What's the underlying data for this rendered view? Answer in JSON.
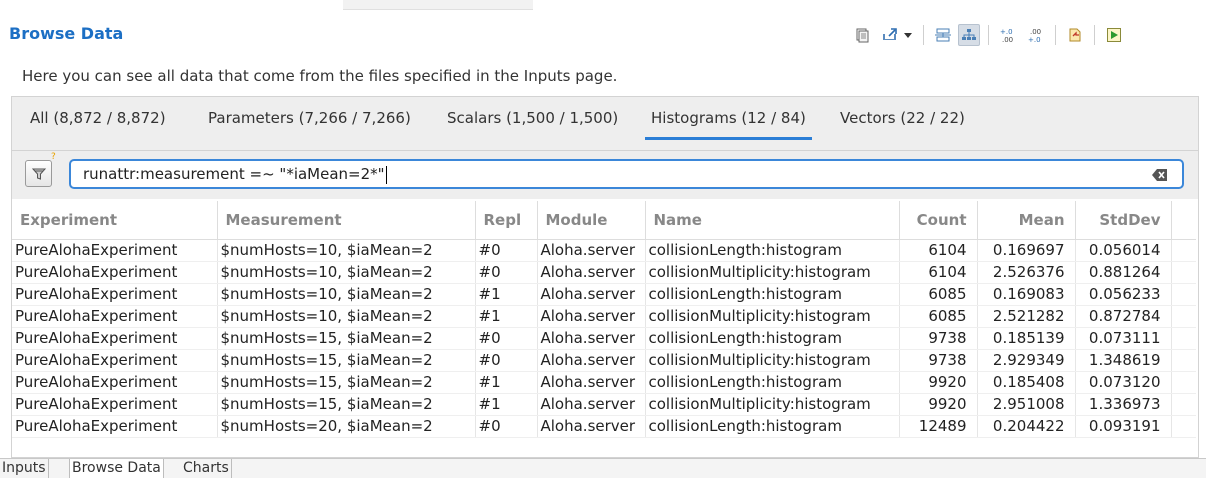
{
  "editor": {
    "title": "Browse Data",
    "description": "Here you can see all data that come from the files specified in the Inputs page."
  },
  "tabs": [
    {
      "label": "All (8,872 / 8,872)"
    },
    {
      "label": "Parameters (7,266 / 7,266)"
    },
    {
      "label": "Scalars (1,500 / 1,500)"
    },
    {
      "label": "Histograms (12 / 84)",
      "selected": true
    },
    {
      "label": "Vectors (22 / 22)"
    }
  ],
  "filter": {
    "value": "runattr:measurement =~ \"*iaMean=2*\""
  },
  "table": {
    "columns": [
      "Experiment",
      "Measurement",
      "Repl",
      "Module",
      "Name",
      "Count",
      "Mean",
      "StdDev"
    ],
    "rows": [
      [
        "PureAlohaExperiment",
        "$numHosts=10, $iaMean=2",
        "#0",
        "Aloha.server",
        "collisionLength:histogram",
        "6104",
        "0.169697",
        "0.056014"
      ],
      [
        "PureAlohaExperiment",
        "$numHosts=10, $iaMean=2",
        "#0",
        "Aloha.server",
        "collisionMultiplicity:histogram",
        "6104",
        "2.526376",
        "0.881264"
      ],
      [
        "PureAlohaExperiment",
        "$numHosts=10, $iaMean=2",
        "#1",
        "Aloha.server",
        "collisionLength:histogram",
        "6085",
        "0.169083",
        "0.056233"
      ],
      [
        "PureAlohaExperiment",
        "$numHosts=10, $iaMean=2",
        "#1",
        "Aloha.server",
        "collisionMultiplicity:histogram",
        "6085",
        "2.521282",
        "0.872784"
      ],
      [
        "PureAlohaExperiment",
        "$numHosts=15, $iaMean=2",
        "#0",
        "Aloha.server",
        "collisionLength:histogram",
        "9738",
        "0.185139",
        "0.073111"
      ],
      [
        "PureAlohaExperiment",
        "$numHosts=15, $iaMean=2",
        "#0",
        "Aloha.server",
        "collisionMultiplicity:histogram",
        "9738",
        "2.929349",
        "1.348619"
      ],
      [
        "PureAlohaExperiment",
        "$numHosts=15, $iaMean=2",
        "#1",
        "Aloha.server",
        "collisionLength:histogram",
        "9920",
        "0.185408",
        "0.073120"
      ],
      [
        "PureAlohaExperiment",
        "$numHosts=15, $iaMean=2",
        "#1",
        "Aloha.server",
        "collisionMultiplicity:histogram",
        "9920",
        "2.951008",
        "1.336973"
      ],
      [
        "PureAlohaExperiment",
        "$numHosts=20, $iaMean=2",
        "#0",
        "Aloha.server",
        "collisionLength:histogram",
        "12489",
        "0.204422",
        "0.093191"
      ]
    ]
  },
  "bottom_tabs": [
    {
      "label": "Inputs"
    },
    {
      "label": "Browse Data",
      "selected": true
    },
    {
      "label": "Charts"
    }
  ],
  "toolbar": {
    "icons": [
      "copy-icon",
      "export-icon",
      "export-dropdown-icon",
      "flat-view-icon",
      "tree-view-icon",
      "increase-decimals-icon",
      "decrease-decimals-icon",
      "open-file-icon",
      "run-icon"
    ]
  },
  "colors": {
    "title": "#1c6fc4",
    "tab_underline": "#2b7ed6",
    "filter_border": "#3b87d9"
  }
}
